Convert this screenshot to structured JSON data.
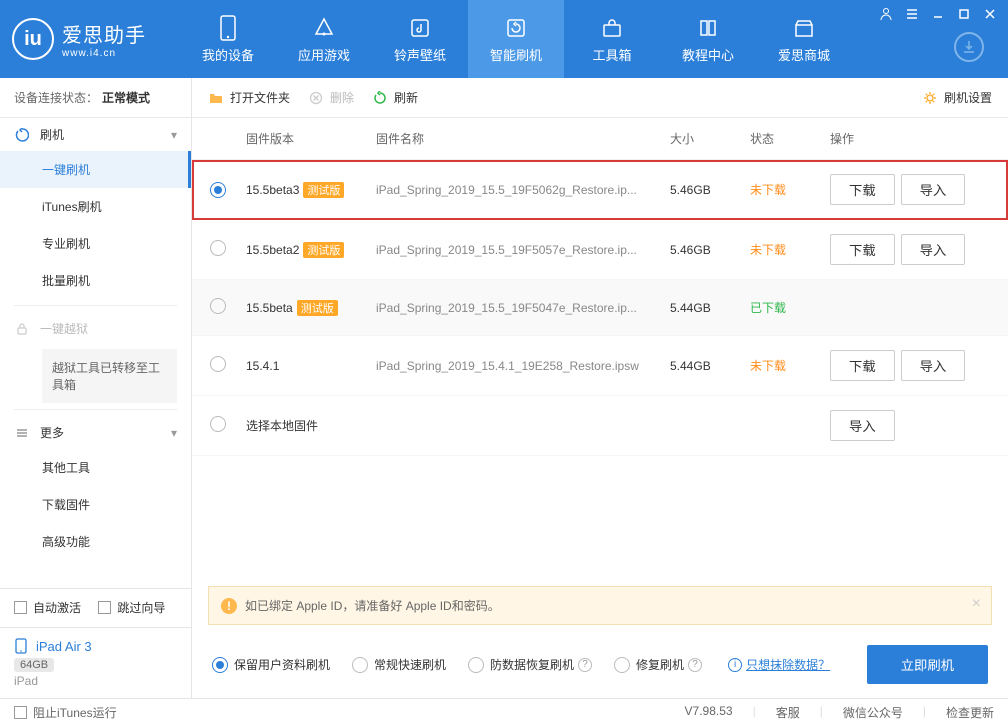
{
  "app": {
    "name": "爱思助手",
    "url": "www.i4.cn",
    "logo_letter": "iu"
  },
  "nav": [
    {
      "label": "我的设备"
    },
    {
      "label": "应用游戏"
    },
    {
      "label": "铃声壁纸"
    },
    {
      "label": "智能刷机",
      "active": true
    },
    {
      "label": "工具箱"
    },
    {
      "label": "教程中心"
    },
    {
      "label": "爱思商城"
    }
  ],
  "sidebar": {
    "status_label": "设备连接状态：",
    "status_value": "正常模式",
    "flash_head": "刷机",
    "items": [
      "一键刷机",
      "iTunes刷机",
      "专业刷机",
      "批量刷机"
    ],
    "jailbreak_head": "一键越狱",
    "jailbreak_note": "越狱工具已转移至工具箱",
    "more_head": "更多",
    "more_items": [
      "其他工具",
      "下载固件",
      "高级功能"
    ],
    "auto_activate": "自动激活",
    "skip_guide": "跳过向导",
    "device": {
      "name": "iPad Air 3",
      "storage": "64GB",
      "type": "iPad"
    }
  },
  "toolbar": {
    "open_folder": "打开文件夹",
    "delete": "删除",
    "refresh": "刷新",
    "settings": "刷机设置"
  },
  "columns": {
    "version": "固件版本",
    "name": "固件名称",
    "size": "大小",
    "status": "状态",
    "action": "操作"
  },
  "rows": [
    {
      "ver": "15.5beta3",
      "beta": "测试版",
      "name": "iPad_Spring_2019_15.5_19F5062g_Restore.ip...",
      "size": "5.46GB",
      "status": "未下载",
      "status_cls": "orange",
      "checked": true,
      "highlight": true,
      "actions": [
        "下载",
        "导入"
      ]
    },
    {
      "ver": "15.5beta2",
      "beta": "测试版",
      "name": "iPad_Spring_2019_15.5_19F5057e_Restore.ip...",
      "size": "5.46GB",
      "status": "未下载",
      "status_cls": "orange",
      "actions": [
        "下载",
        "导入"
      ]
    },
    {
      "ver": "15.5beta",
      "beta": "测试版",
      "name": "iPad_Spring_2019_15.5_19F5047e_Restore.ip...",
      "size": "5.44GB",
      "status": "已下载",
      "status_cls": "green",
      "shade": true,
      "actions": []
    },
    {
      "ver": "15.4.1",
      "beta": "",
      "name": "iPad_Spring_2019_15.4.1_19E258_Restore.ipsw",
      "size": "5.44GB",
      "status": "未下载",
      "status_cls": "orange",
      "actions": [
        "下载",
        "导入"
      ]
    },
    {
      "ver": "选择本地固件",
      "beta": "",
      "name": "",
      "size": "",
      "status": "",
      "status_cls": "",
      "actions": [
        "导入"
      ]
    }
  ],
  "notice": "如已绑定 Apple ID，请准备好 Apple ID和密码。",
  "options": {
    "keep_data": "保留用户资料刷机",
    "quick": "常规快速刷机",
    "anti_loss": "防数据恢复刷机",
    "repair": "修复刷机",
    "erase_link": "只想抹除数据？",
    "flash_now": "立即刷机"
  },
  "footer": {
    "block_itunes": "阻止iTunes运行",
    "version": "V7.98.53",
    "service": "客服",
    "wechat": "微信公众号",
    "update": "检查更新"
  }
}
